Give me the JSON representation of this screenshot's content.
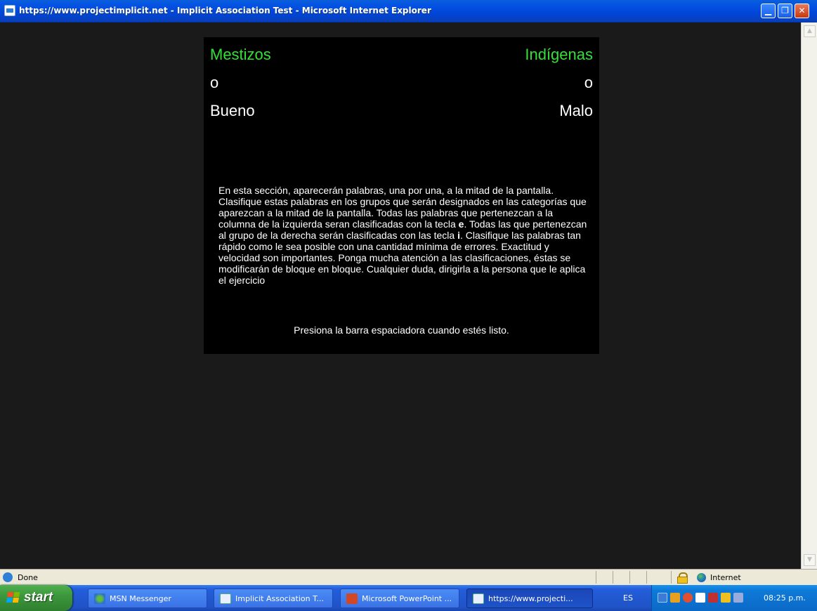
{
  "window": {
    "title": "https://www.projectimplicit.net - Implicit Association Test - Microsoft Internet Explorer",
    "icons": {
      "app": "ie-page-icon",
      "minimize": "minimize-icon",
      "maximize": "restore-icon",
      "close": "close-icon"
    }
  },
  "iat": {
    "left_category": "Mestizos",
    "right_category": "Indígenas",
    "left_or": "o",
    "right_or": "o",
    "left_attribute": "Bueno",
    "right_attribute": "Malo",
    "instructions_part1": "En esta sección, aparecerán palabras, una por una, a la mitad de la pantalla. Clasifique estas palabras en los grupos que serán designados en las categorías que aparezcan a la mitad de la pantalla. Todas las palabras que pertenezcan a la columna de la izquierda seran clasificadas con la tecla ",
    "key_left": "e",
    "instructions_part2": ". Todas las que pertenezcan al grupo de la derecha serán clasificadas con las tecla ",
    "key_right": "i",
    "instructions_part3": ". Clasifique las palabras tan rápido como le sea posible con una cantidad mínima de errores. Exactitud y velocidad son importantes. Ponga mucha atención a las clasificaciones, éstas se modificarán de bloque en bloque. Cualquier duda, dirigirla a la persona que le aplica el ejercicio",
    "prompt": "Presiona la barra espaciadora cuando estés listo.",
    "colors": {
      "category": "#33e035",
      "attribute": "#ffffff",
      "background": "#000000"
    }
  },
  "statusbar": {
    "status": "Done",
    "zone": "Internet"
  },
  "taskbar": {
    "start_label": "start",
    "tasks": [
      {
        "label": "MSN Messenger",
        "icon": "msn-icon"
      },
      {
        "label": "Implicit Association T...",
        "icon": "ie-icon"
      },
      {
        "label": "Microsoft PowerPoint ...",
        "icon": "powerpoint-icon"
      },
      {
        "label": "https://www.projecti...",
        "icon": "ie-icon"
      }
    ],
    "language": "ES",
    "clock": "08:25 p.m."
  }
}
